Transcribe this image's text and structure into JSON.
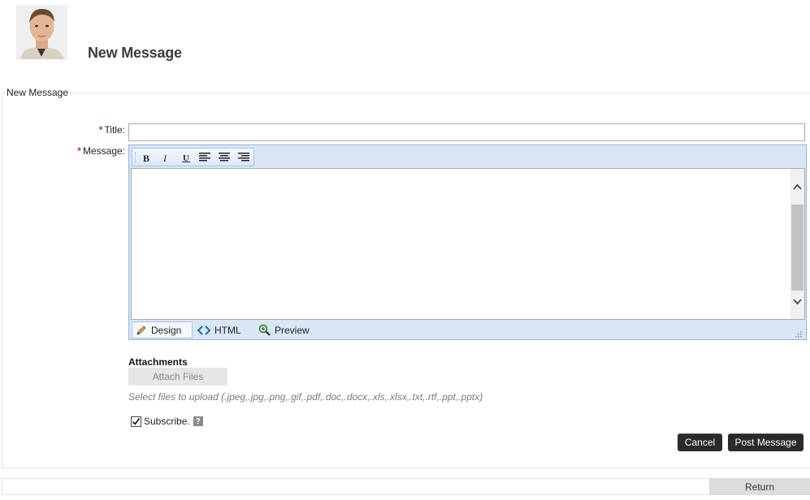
{
  "header": {
    "avatar_alt": "user avatar",
    "title": "New Message"
  },
  "form": {
    "legend": "New Message",
    "title_label": "Title:",
    "title_value": "",
    "message_label": "Message:",
    "required_marker": "*",
    "editor": {
      "toolbar": [
        "bold-icon",
        "italic-icon",
        "underline-icon",
        "align-left-icon",
        "align-center-icon",
        "align-right-icon"
      ],
      "modes": {
        "design": "Design",
        "html": "HTML",
        "preview": "Preview"
      },
      "active_mode": "Design",
      "content": ""
    },
    "attachments": {
      "heading": "Attachments",
      "button": "Attach Files",
      "hint": "Select files to upload (.jpeg,.jpg,.png,.gif,.pdf,.doc,.docx,.xls,.xlsx,.txt,.rtf,.ppt,.pptx)"
    },
    "subscribe": {
      "label": "Subscribe.",
      "checked": true,
      "help": "?"
    },
    "actions": {
      "cancel": "Cancel",
      "post": "Post Message"
    }
  },
  "footer": {
    "return": "Return"
  },
  "colors": {
    "editor_frame": "#d8e6f6",
    "required": "#d9261c",
    "button_dark": "#2a2a2a"
  }
}
